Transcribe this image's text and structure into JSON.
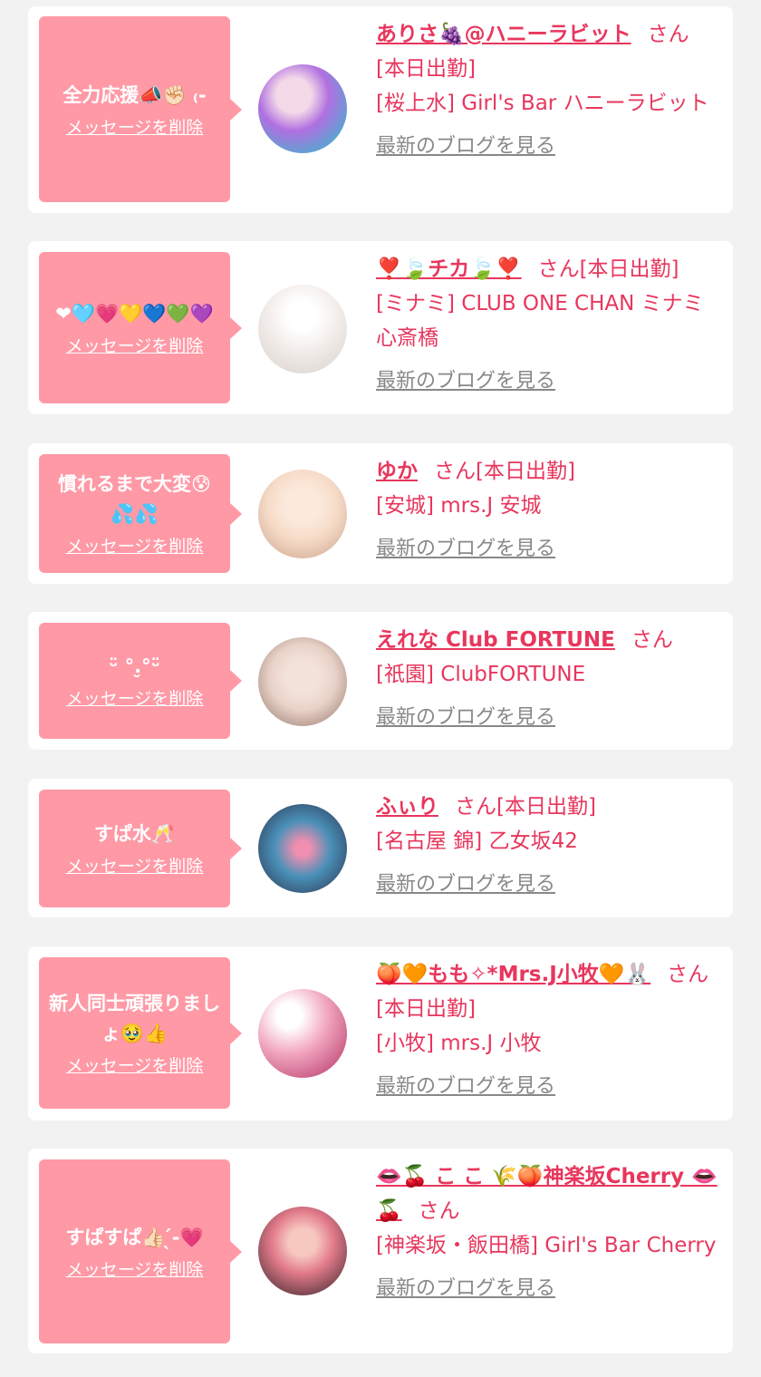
{
  "cards": [
    {
      "message": "全力応援📣✊🏻 ₍-",
      "delete_label": "メッセージを削除",
      "name": "ありさ🍇@ハニーラビット",
      "san": "さん",
      "status": "[本日出勤]",
      "shop": "[桜上水] Girl's Bar ハニーラビット",
      "blog_label": "最新のブログを見る",
      "avatar_colors": [
        "#b070e0",
        "#1ec8c8"
      ]
    },
    {
      "message": "❤🩵💗💛💙💚💜",
      "delete_label": "メッセージを削除",
      "name": "❣️🍃チカ🍃❣️",
      "san": "さん",
      "status": "[本日出勤]",
      "shop": "[ミナミ] CLUB ONE CHAN ミナミ 心斎橋",
      "blog_label": "最新のブログを見る",
      "avatar_colors": [
        "#f4efec",
        "#d8d0cc"
      ]
    },
    {
      "message": "慣れるまで大変😰💦💦",
      "delete_label": "メッセージを削除",
      "name": "ゆか",
      "san": "さん",
      "status": "[本日出勤]",
      "shop": "[安城] mrs.J 安城",
      "blog_label": "最新のブログを見る",
      "avatar_colors": [
        "#f6dcc8",
        "#c9a08a"
      ]
    },
    {
      "message": "ᵕ̈ °.̮°ᵕ̈",
      "delete_label": "メッセージを削除",
      "name": "えれな Club FORTUNE",
      "san": "さん",
      "status": "",
      "shop": "[祇園] ClubFORTUNE",
      "blog_label": "最新のブログを見る",
      "avatar_colors": [
        "#e8d2c8",
        "#8e6e62"
      ]
    },
    {
      "message": "すぱ水🥂",
      "delete_label": "メッセージを削除",
      "name": "ふぃり",
      "san": "さん",
      "status": "[本日出勤]",
      "shop": "[名古屋 錦] 乙女坂42",
      "blog_label": "最新のブログを見る",
      "avatar_colors": [
        "#4a90b8",
        "#2a2f4a"
      ]
    },
    {
      "message": "新人同士頑張りましょ🥹👍",
      "delete_label": "メッセージを削除",
      "name": "🍑🧡もも✧*Mrs.J小牧🧡🐰",
      "san": "さん",
      "status": "[本日出勤]",
      "shop": "[小牧] mrs.J 小牧",
      "blog_label": "最新のブログを見る",
      "avatar_colors": [
        "#f2a6c0",
        "#b03060"
      ]
    },
    {
      "message": "すぱすぱ👍🏻 ̖́-💗",
      "delete_label": "メッセージを削除",
      "name": "👄🍒 こ こ 🌾🍑神楽坂Cherry 👄🍒",
      "san": "さん",
      "status": "",
      "shop": "[神楽坂・飯田橋] Girl's Bar Cherry",
      "blog_label": "最新のブログを見る",
      "avatar_colors": [
        "#e27a8a",
        "#2c2024"
      ]
    }
  ]
}
